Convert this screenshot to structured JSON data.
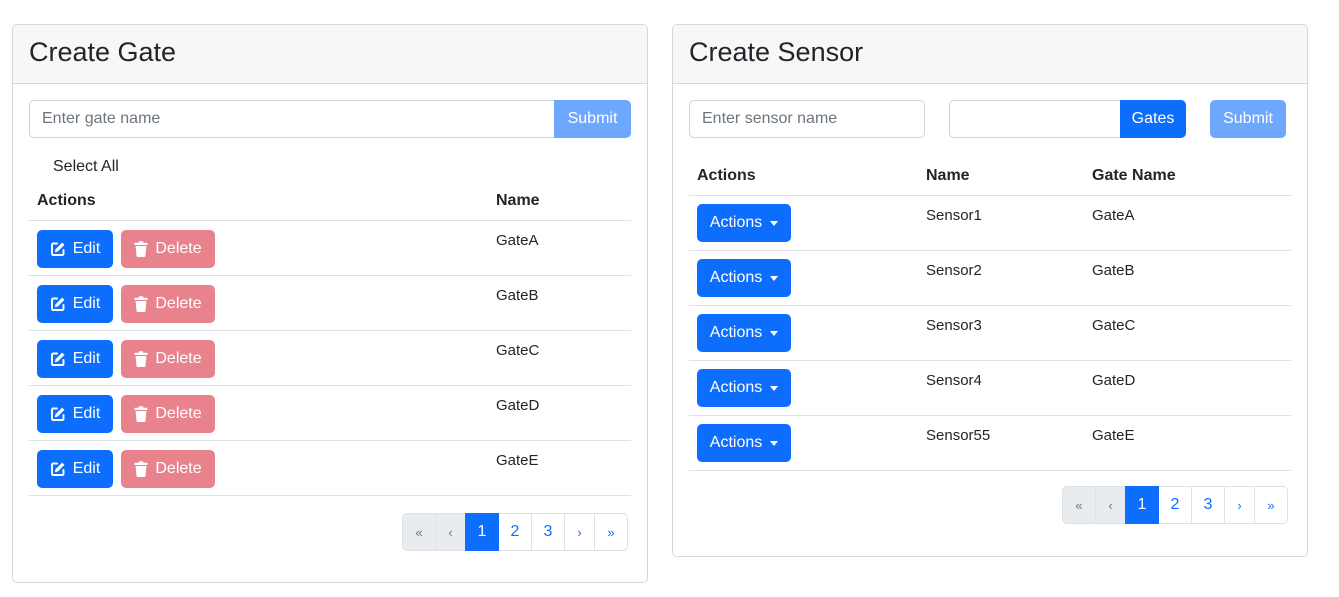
{
  "gate_panel": {
    "title": "Create Gate",
    "input_placeholder": "Enter gate name",
    "submit_label": "Submit",
    "select_all_label": "Select All",
    "columns": {
      "actions": "Actions",
      "name": "Name"
    },
    "edit_label": "Edit",
    "delete_label": "Delete",
    "rows": [
      {
        "name": "GateA"
      },
      {
        "name": "GateB"
      },
      {
        "name": "GateC"
      },
      {
        "name": "GateD"
      },
      {
        "name": "GateE"
      }
    ],
    "pagination": {
      "first": "«",
      "prev": "‹",
      "pages": [
        "1",
        "2",
        "3"
      ],
      "active_page": "1",
      "next": "›",
      "last": "»"
    }
  },
  "sensor_panel": {
    "title": "Create Sensor",
    "input_placeholder": "Enter sensor name",
    "gate_select_value": "",
    "gates_button_label": "Gates",
    "submit_label": "Submit",
    "columns": {
      "actions": "Actions",
      "name": "Name",
      "gate_name": "Gate Name"
    },
    "actions_label": "Actions",
    "rows": [
      {
        "name": "Sensor1",
        "gate": "GateA"
      },
      {
        "name": "Sensor2",
        "gate": "GateB"
      },
      {
        "name": "Sensor3",
        "gate": "GateC"
      },
      {
        "name": "Sensor4",
        "gate": "GateD"
      },
      {
        "name": "Sensor55",
        "gate": "GateE"
      }
    ],
    "pagination": {
      "first": "«",
      "prev": "‹",
      "pages": [
        "1",
        "2",
        "3"
      ],
      "active_page": "1",
      "next": "›",
      "last": "»"
    }
  },
  "icons": {
    "edit": "edit-square-icon",
    "delete": "trash-icon",
    "dropdown": "caret-down-icon"
  },
  "colors": {
    "primary": "#0d6efd",
    "primary_disabled": "#6ea8fe",
    "danger_disabled": "#e8838e",
    "header_bg": "#f7f7f7"
  }
}
